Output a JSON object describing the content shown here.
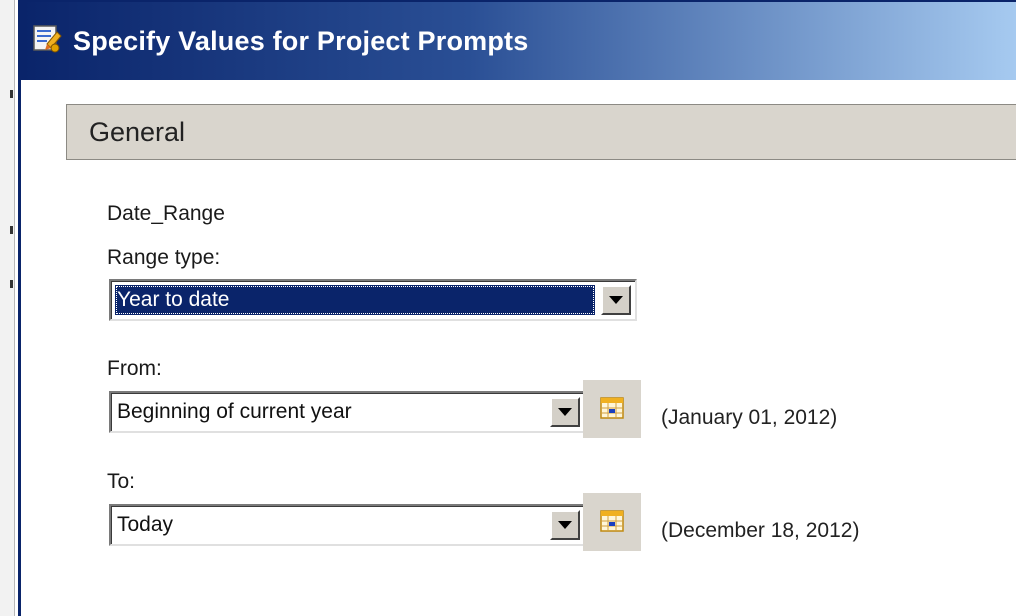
{
  "window": {
    "title": "Specify Values for Project Prompts",
    "title_color": "#ffffff",
    "titlebar_color": "#0a246a"
  },
  "section": {
    "title": "General"
  },
  "prompt": {
    "name": "Date_Range",
    "range_type_label": "Range type:",
    "range_type_value": "Year to date",
    "from_label": "From:",
    "from_value": "Beginning of current year",
    "from_resolved": "(January 01, 2012)",
    "to_label": "To:",
    "to_value": "Today",
    "to_resolved": "(December 18, 2012)"
  },
  "icons": {
    "app": "prompt-wizard-icon",
    "dropdown": "chevron-down-icon",
    "calendar": "calendar-icon"
  },
  "colors": {
    "selection": "#0a246a",
    "section_header": "#d9d5cd",
    "calendar_accent": "#f0b020",
    "calendar_marker": "#1a40c0"
  }
}
